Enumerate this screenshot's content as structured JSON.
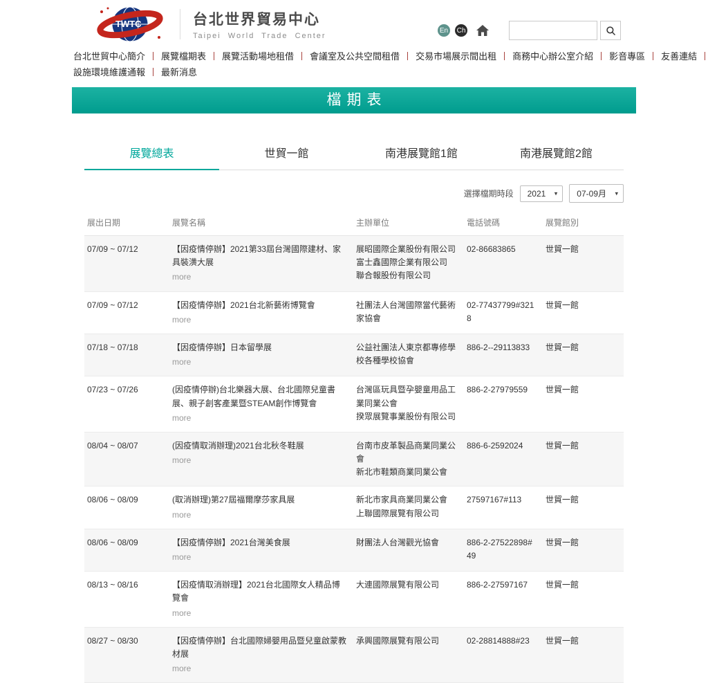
{
  "colors": {
    "accent": "#00a79b",
    "banner_top": "#1cb2a2",
    "banner_bottom": "#009c8e"
  },
  "header": {
    "logo_text": "TWTC",
    "title_zh": "台北世界貿易中心",
    "title_en": "Taipei World Trade Center",
    "lang": {
      "en": "En",
      "ch": "Ch"
    },
    "search": {
      "value": "",
      "placeholder": ""
    }
  },
  "nav": {
    "row1": [
      "台北世貿中心簡介",
      "展覽檔期表",
      "展覽活動場地租借",
      "會議室及公共空間租借",
      "交易市場展示間出租",
      "商務中心辦公室介紹",
      "影音專區",
      "友善連結"
    ],
    "row2": [
      "設施環境維護通報",
      "最新消息"
    ]
  },
  "banner": {
    "title": "檔期表"
  },
  "tabs": [
    {
      "label": "展覽總表",
      "active": true
    },
    {
      "label": "世貿一館",
      "active": false
    },
    {
      "label": "南港展覽館1館",
      "active": false
    },
    {
      "label": "南港展覽館2館",
      "active": false
    }
  ],
  "filter": {
    "label": "選擇檔期時段",
    "year": "2021",
    "period": "07-09月"
  },
  "table": {
    "headers": [
      "展出日期",
      "展覽名稱",
      "主辦單位",
      "電話號碼",
      "展覽館別"
    ],
    "more_label": "more",
    "rows": [
      {
        "date": "07/09 ~ 07/12",
        "name": "【因疫情停辦】2021第33屆台灣國際建材、家具裝潢大展",
        "organizers": [
          "展昭國際企業股份有限公司",
          "富士鑫國際企業有限公司",
          "聯合報股份有限公司"
        ],
        "phone": "02-86683865",
        "venue": "世貿一館"
      },
      {
        "date": "07/09 ~ 07/12",
        "name": "【因疫情停辦】2021台北新藝術博覽會",
        "organizers": [
          "社團法人台灣國際當代藝術家協會"
        ],
        "phone": "02-77437799#3218",
        "venue": "世貿一館"
      },
      {
        "date": "07/18 ~ 07/18",
        "name": "【因疫情停辦】日本留學展",
        "organizers": [
          "公益社團法人東京都專修學校各種學校協會"
        ],
        "phone": "886-2--29113833",
        "venue": "世貿一館"
      },
      {
        "date": "07/23 ~ 07/26",
        "name": "(因疫情停辦)台北樂器大展、台北國際兒童書展、親子創客產業暨STEAM創作博覽會",
        "organizers": [
          "台灣區玩具暨孕嬰童用品工業同業公會",
          "揆眾展覽事業股份有限公司"
        ],
        "phone": "886-2-27979559",
        "venue": "世貿一館"
      },
      {
        "date": "08/04 ~ 08/07",
        "name": "(因疫情取消辦理)2021台北秋冬鞋展",
        "organizers": [
          "台南市皮革製品商業同業公會",
          "新北市鞋類商業同業公會"
        ],
        "phone": "886-6-2592024",
        "venue": "世貿一館"
      },
      {
        "date": "08/06 ~ 08/09",
        "name": "(取消辦理)第27屆福爾摩莎家具展",
        "organizers": [
          "新北市家具商業同業公會",
          "上聯國際展覽有限公司"
        ],
        "phone": "27597167#113",
        "venue": "世貿一館"
      },
      {
        "date": "08/06 ~ 08/09",
        "name": "【因疫情停辦】2021台灣美食展",
        "organizers": [
          "財團法人台灣觀光協會"
        ],
        "phone": "886-2-27522898#49",
        "venue": "世貿一館"
      },
      {
        "date": "08/13 ~ 08/16",
        "name": "【因疫情取消辦理】2021台北國際女人精品博覽會",
        "organizers": [
          "大連國際展覽有限公司"
        ],
        "phone": "886-2-27597167",
        "venue": "世貿一館"
      },
      {
        "date": "08/27 ~ 08/30",
        "name": "【因疫情停辦】台北國際婦嬰用品暨兒童啟蒙教材展",
        "organizers": [
          "承興國際展覽有限公司"
        ],
        "phone": "02-28814888#23",
        "venue": "世貿一館"
      }
    ]
  }
}
